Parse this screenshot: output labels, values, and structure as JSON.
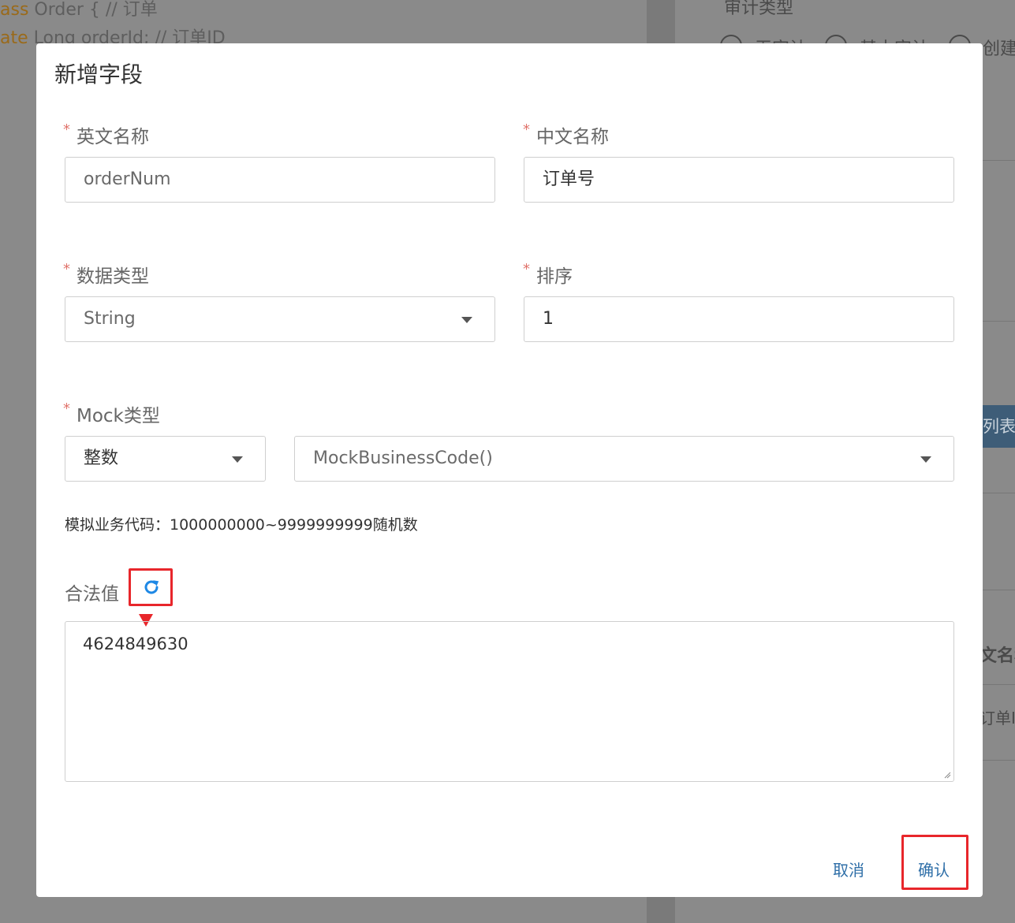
{
  "background": {
    "code_line1_kw": "ass",
    "code_line1": " Order { // 订单",
    "code_line2_kw": "ate",
    "code_line2": " Long orderId; // 订单ID",
    "right_heading": "审计类型",
    "radio_label_1": "无审计",
    "radio_label_2": "基本审计",
    "radio_label_3": "创建",
    "list_button": "列表",
    "col_header": "文名称",
    "row_cell": "订单ID"
  },
  "modal": {
    "title": "新增字段",
    "required_mark": "*",
    "english_name": {
      "label": "英文名称",
      "value": "orderNum"
    },
    "chinese_name": {
      "label": "中文名称",
      "value": "订单号"
    },
    "data_type": {
      "label": "数据类型",
      "value": "String"
    },
    "sort": {
      "label": "排序",
      "value": "1"
    },
    "mock_type": {
      "label": "Mock类型",
      "category": "整数",
      "function": "MockBusinessCode()"
    },
    "hint": "模拟业务代码：1000000000~9999999999随机数",
    "legal_value": {
      "label": "合法值",
      "value": "4624849630"
    },
    "cancel_label": "取消",
    "confirm_label": "确认"
  },
  "colors": {
    "highlight": "#e8262b",
    "link": "#2f6fa8",
    "refresh_icon": "#1e88e5"
  }
}
